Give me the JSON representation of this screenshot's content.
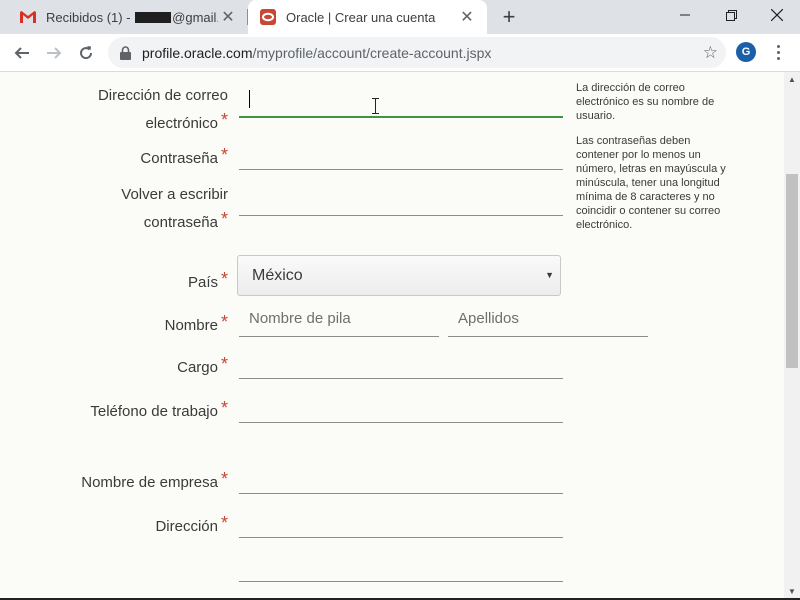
{
  "browser": {
    "tabs": [
      {
        "title_prefix": "Recibidos (1) - ",
        "title_suffix": "@gmail.co",
        "icon": "gmail-icon"
      },
      {
        "title": "Oracle | Crear una cuenta",
        "icon": "oracle-icon"
      }
    ],
    "url_host": "profile.oracle.com",
    "url_path": "/myprofile/account/create-account.jspx",
    "avatar_letter": "G"
  },
  "form": {
    "email_label_line1": "Dirección de correo",
    "email_label_line2": "electrónico",
    "password_label": "Contraseña",
    "confirm_label_line1": "Volver a escribir",
    "confirm_label_line2": "contraseña",
    "country_label": "País",
    "country_value": "México",
    "name_label": "Nombre",
    "first_name_placeholder": "Nombre de pila",
    "last_name_placeholder": "Apellidos",
    "job_label": "Cargo",
    "phone_label": "Teléfono de trabajo",
    "company_label": "Nombre de empresa",
    "address_label": "Dirección",
    "required_mark": "*"
  },
  "help": {
    "email_help": "La dirección de correo electrónico es su nombre de usuario.",
    "password_help": "Las contraseñas deben contener por lo menos un número, letras en mayúscula y minúscula, tener una longitud mínima de 8 caracteres y no coincidir o contener su correo electrónico."
  },
  "colors": {
    "accent_required": "#c74634",
    "active_underline": "#3f9544",
    "avatar": "#1a5fa8"
  }
}
